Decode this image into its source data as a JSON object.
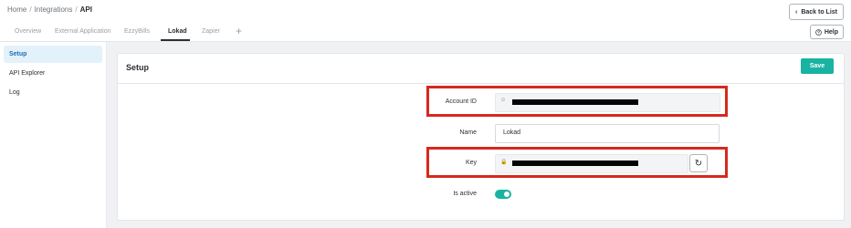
{
  "breadcrumb": {
    "items": [
      "Home",
      "Integrations",
      "API"
    ],
    "separator": "/"
  },
  "header": {
    "back_label": "Back to List",
    "back_icon": "chevron-left-icon",
    "help_label": "Help",
    "help_icon": "question-circle-icon"
  },
  "tabs": [
    {
      "label": "Overview",
      "active": false
    },
    {
      "label": "External Application",
      "active": false
    },
    {
      "label": "EzzyBills",
      "active": false
    },
    {
      "label": "Lokad",
      "active": true
    },
    {
      "label": "Zapier",
      "active": false
    }
  ],
  "add_tab_label": "+",
  "sidebar": {
    "items": [
      {
        "label": "Setup",
        "active": true
      },
      {
        "label": "API Explorer",
        "active": false
      },
      {
        "label": "Log",
        "active": false
      }
    ]
  },
  "card": {
    "title": "Setup",
    "save_label": "Save"
  },
  "form": {
    "account_id": {
      "label": "Account ID",
      "icon": "user-icon",
      "value_redacted": true
    },
    "name": {
      "label": "Name",
      "value": "Lokad"
    },
    "key": {
      "label": "Key",
      "icon": "lock-icon",
      "value_redacted": true,
      "refresh_icon": "refresh-icon"
    },
    "is_active": {
      "label": "Is active",
      "value": true
    }
  },
  "colors": {
    "accent": "#19b3a2",
    "highlight": "#d6291c",
    "sidebar_active_bg": "#e3f1fb",
    "sidebar_active_text": "#1d6fb5"
  }
}
